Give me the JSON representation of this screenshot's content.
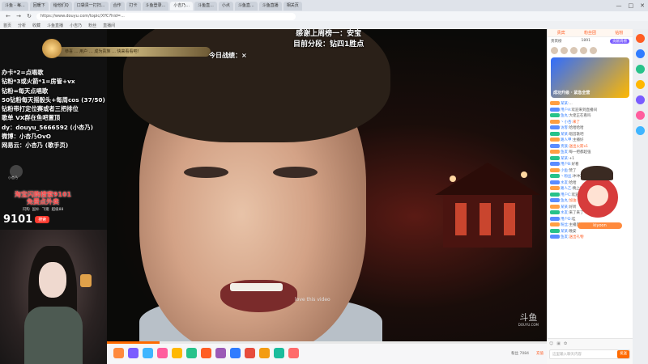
{
  "browser": {
    "tabs": [
      "斗鱼 - 每...",
      "回暖下",
      "给他们Q",
      "口袋贵一打扫...",
      "合作",
      "打卡",
      "斗鱼登录...",
      "小吉乃...",
      "斗鱼直...",
      "小点",
      "斗鱼直...",
      "斗鱼直播",
      "相关页"
    ],
    "active_tab_index": 7,
    "url": "https://www.douyu.com/topic/XYC?hid=...",
    "bookmarks": [
      "首页",
      "分析",
      "收藏",
      "斗鱼直播",
      "小吉乃",
      "粉丝",
      "直播间"
    ],
    "window_controls": [
      "—",
      "□",
      "✕"
    ],
    "nav_icons": [
      "←",
      "→",
      "↻"
    ]
  },
  "overlay": {
    "thanks_line": "感谢上周榜一：安宝",
    "rank_line": "目前分段：钻四1胜点",
    "record_label": "今日战绩：×",
    "notice_text": "恭喜 … 用户 … 成为贵族 … 快来看看吧！",
    "rules": [
      "办卡*2=点唱歌",
      "钻粉*3或火箭*1=房管+vx",
      "钻粉=每天点唱歌",
      "50钻粉每天摇骰头+每周cos (37/50)",
      "钻粉带打定位赛或者三把排位",
      "歌单 VX群在鱼吧置顶",
      "dy：douyu_5666592 (小杏乃)",
      "微博：小杏乃OvO",
      "网易云：小杏乃 (歌手页)"
    ],
    "small_avatar_label": "小杏乃"
  },
  "promo": {
    "line1": "淘宝闪购搜索9101",
    "line2": "免费点外卖",
    "tags": [
      "闪购",
      "国补",
      "飞猪",
      "超级88"
    ],
    "number": "9101",
    "search_label": "搜索"
  },
  "video": {
    "subtitle": "love this video",
    "watermark": "斗鱼",
    "watermark_sub": "DOUYU.COM",
    "progress_fraction": 0.12
  },
  "gift_bar": {
    "gift_colors": [
      "#ff8a3d",
      "#7a5cff",
      "#3fb5ff",
      "#ff5d9e",
      "#ffb800",
      "#27c28a",
      "#ff5d23",
      "#9b59b6",
      "#2f7cff",
      "#e74c3c",
      "#f39c12",
      "#1abc9c",
      "#ff6b6b"
    ],
    "right_label": "粉丝 7084",
    "recharge": "充值"
  },
  "panel": {
    "tabs": [
      "贵宾",
      "粉丝团",
      "钻粉"
    ],
    "rank_title": "贵宾榜",
    "rank_count": "1891",
    "rank_button": "贡献周榜",
    "promo_card_text": "成功升级 · 紧急全营",
    "chat": [
      {
        "badge": "b1",
        "nick": "某某:",
        "text": "...",
        "hl": false
      },
      {
        "badge": "b2",
        "nick": "用户A:",
        "text": "欢迎来到直播间",
        "hl": false
      },
      {
        "badge": "b3",
        "nick": "鱼丸:",
        "text": "大佬正在看吗",
        "hl": false
      },
      {
        "badge": "b1",
        "nick": "丶小杏:",
        "text": "来了",
        "hl": true
      },
      {
        "badge": "b2",
        "nick": "访客:",
        "text": "哈哈哈哈",
        "hl": false
      },
      {
        "badge": "b3",
        "nick": "某某:",
        "text": "唱首歌吧",
        "hl": false
      },
      {
        "badge": "b1",
        "nick": "路人甲:",
        "text": "主播好",
        "hl": false
      },
      {
        "badge": "b2",
        "nick": "贵族:",
        "text": "送出火箭x1",
        "hl": true
      },
      {
        "badge": "b1",
        "nick": "鱼友:",
        "text": "每一把都超强",
        "hl": false
      },
      {
        "badge": "b3",
        "nick": "某某:",
        "text": "+1",
        "hl": false
      },
      {
        "badge": "b2",
        "nick": "用户B:",
        "text": "好看",
        "hl": false
      },
      {
        "badge": "b1",
        "nick": "小鱼:",
        "text": "赞了",
        "hl": false
      },
      {
        "badge": "b3",
        "nick": "丶粉丝:",
        "text": "冲冲冲",
        "hl": false
      },
      {
        "badge": "b2",
        "nick": "水友:",
        "text": "哈哈",
        "hl": false
      },
      {
        "badge": "b1",
        "nick": "路人乙:",
        "text": "晚上好",
        "hl": false
      },
      {
        "badge": "b3",
        "nick": "用户C:",
        "text": "欢迎欢迎",
        "hl": false
      },
      {
        "badge": "b2",
        "nick": "鱼丸:",
        "text": "加油",
        "hl": true
      },
      {
        "badge": "b1",
        "nick": "某某:",
        "text": "好听",
        "hl": false
      },
      {
        "badge": "b3",
        "nick": "水友:",
        "text": "来了来了",
        "hl": false
      },
      {
        "badge": "b2",
        "nick": "用户D:",
        "text": "哇",
        "hl": false
      },
      {
        "badge": "b1",
        "nick": "粉丝:",
        "text": "主播厉害",
        "hl": false
      },
      {
        "badge": "b3",
        "nick": "某某:",
        "text": "晚安",
        "hl": false
      },
      {
        "badge": "b2",
        "nick": "鱼友:",
        "text": "送出礼物",
        "hl": true
      }
    ],
    "mascot_name": "kiyoon",
    "input_placeholder": "这里输入聊天内容",
    "send_label": "发送",
    "input_icons": [
      "☺",
      "▣",
      "✿"
    ]
  },
  "rail_colors": [
    "#ff5d23",
    "#2f7cff",
    "#27c28a",
    "#ffb800",
    "#7a5cff",
    "#ff5d9e",
    "#3fb5ff"
  ]
}
